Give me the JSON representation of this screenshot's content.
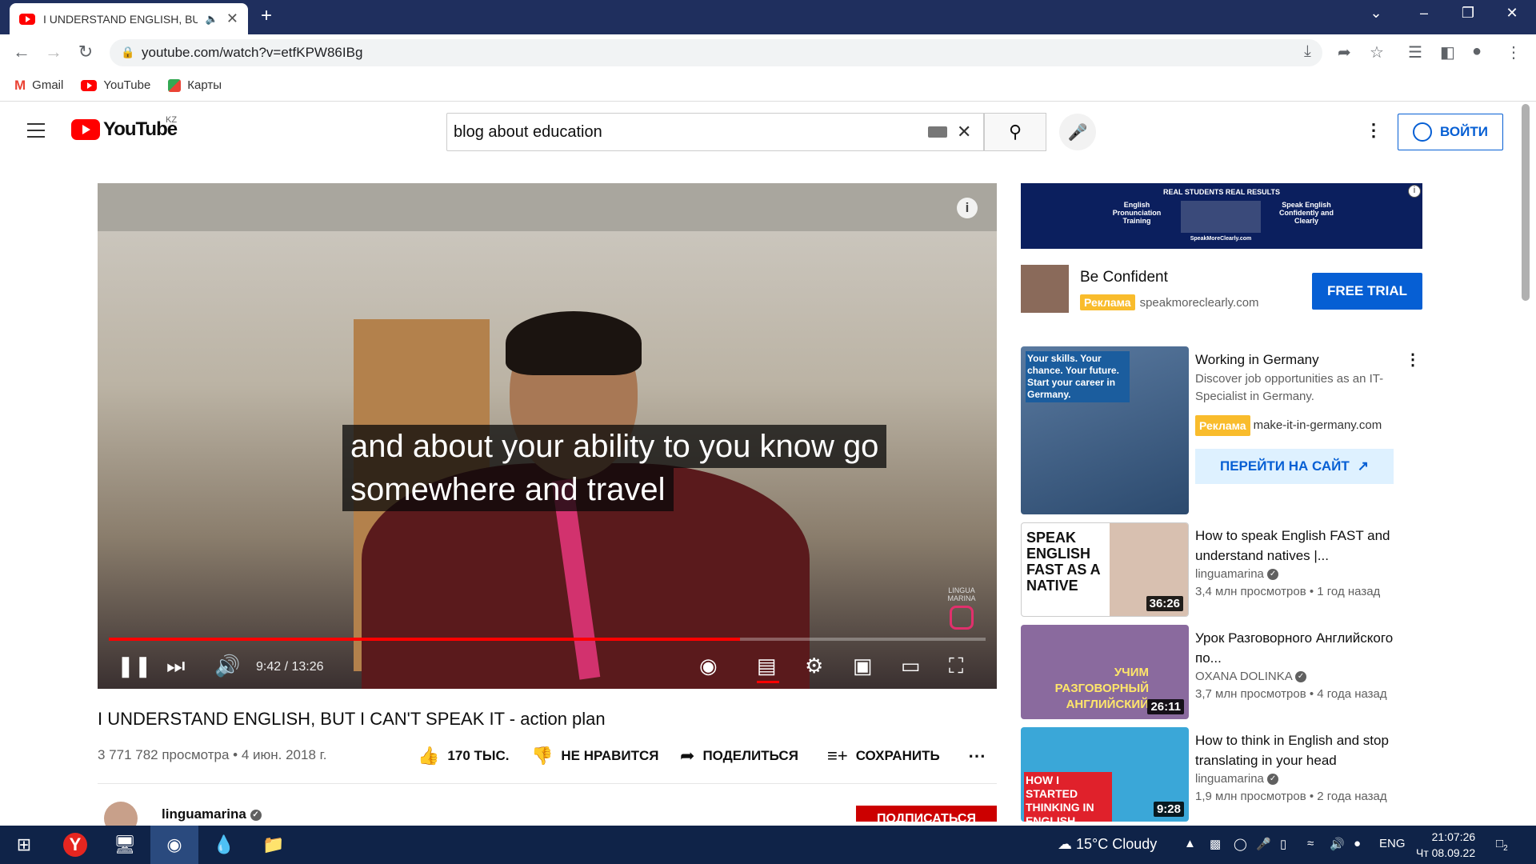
{
  "browser": {
    "tab_title": "I UNDERSTAND ENGLISH, BU",
    "new_tab": "+",
    "url": "youtube.com/watch?v=etfKPW86IBg",
    "bookmarks": [
      {
        "label": "Gmail",
        "icon": "gmail-icon"
      },
      {
        "label": "YouTube",
        "icon": "youtube-icon"
      },
      {
        "label": "Карты",
        "icon": "maps-icon"
      }
    ]
  },
  "header": {
    "logo_text": "YouTube",
    "region": "KZ",
    "search_value": "blog about education",
    "signin_label": "ВОЙТИ"
  },
  "video": {
    "caption_line1": "and about your ability to you know go",
    "caption_line2": "somewhere and travel",
    "time_current": "9:42",
    "time_total": "13:26",
    "timecode": "9:42 / 13:26",
    "progress": 0.72,
    "watermark": "LINGUA MARINA",
    "title": "I UNDERSTAND ENGLISH, BUT I CAN'T SPEAK IT - action plan",
    "views_date": "3 771 782 просмотра • 4 июн. 2018 г.",
    "likes": "170 ТЫС.",
    "dislike_label": "НЕ НРАВИТСЯ",
    "share_label": "ПОДЕЛИТЬСЯ",
    "save_label": "СОХРАНИТЬ",
    "channel": "linguamarina",
    "subscribe_label": "ПОДПИСАТЬСЯ"
  },
  "sidebar": {
    "banner": {
      "top": "REAL STUDENTS REAL RESULTS",
      "left": "English Pronunciation Training",
      "right": "Speak English Confidently and Clearly",
      "url": "SpeakMoreClearly.com"
    },
    "ad1": {
      "title": "Be Confident",
      "badge": "Реклама",
      "domain": "speakmoreclearly.com",
      "cta": "FREE TRIAL"
    },
    "ad2": {
      "title": "Working in Germany",
      "desc": "Discover job opportunities as an IT-Specialist in Germany.",
      "badge": "Реклама",
      "domain": "make-it-in-germany.com",
      "cta": "ПЕРЕЙТИ НА САЙТ",
      "thumb_text": "Your skills. Your chance. Your future. Start your career in Germany."
    },
    "recs": [
      {
        "title": "How to speak English FAST and understand natives |...",
        "channel": "linguamarina",
        "meta": "3,4 млн просмотров • 1 год назад",
        "duration": "36:26",
        "thumb_text": "SPEAK ENGLISH FAST AS A NATIVE"
      },
      {
        "title": "Урок Разговорного Английского по...",
        "channel": "OXANA DOLINKA",
        "meta": "3,7 млн просмотров • 4 года назад",
        "duration": "26:11",
        "thumb_text": "УЧИМ РАЗГОВОРНЫЙ АНГЛИЙСКИЙ"
      },
      {
        "title": "How to think in English and stop translating in your head",
        "channel": "linguamarina",
        "meta": "1,9 млн просмотров • 2 года назад",
        "duration": "9:28",
        "thumb_text": "HOW I STARTED THINKING IN ENGLISH"
      }
    ]
  },
  "taskbar": {
    "weather": "15°C  Cloudy",
    "lang": "ENG",
    "time": "21:07:26",
    "date": "Чт 08.09.22",
    "notif": "2"
  }
}
